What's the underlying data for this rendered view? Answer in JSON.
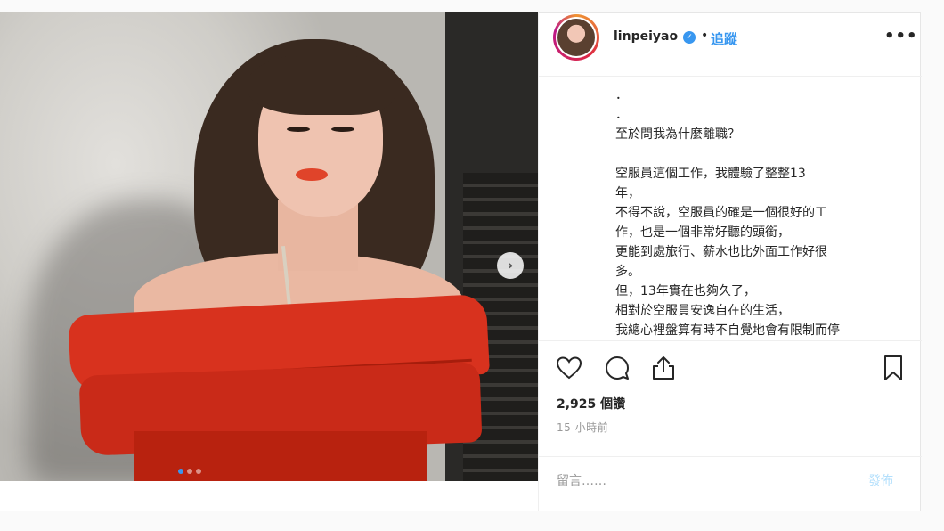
{
  "header": {
    "username": "linpeiyao",
    "separator": "•",
    "follow_label": "追蹤",
    "more_label": "•••"
  },
  "caption": {
    "lines": [
      "．",
      "．",
      "至於問我為什麼離職？",
      "",
      "空服員這個工作，我體驗了整整13",
      "年，",
      "不得不說，空服員的確是一個很好的工",
      "作，也是一個非常好聽的頭銜，",
      "更能到處旅行、薪水也比外面工作好很",
      "多。",
      "但，13年實在也夠久了，",
      "相對於空服員安逸自在的生活，",
      "我總心裡盤算有時不自覺地會有限制而停"
    ]
  },
  "media": {
    "carousel_dots": 3,
    "active_dot": 0
  },
  "actions": {
    "views": "2,925 個讚",
    "time": "15 小時前"
  },
  "comment": {
    "placeholder": "留言……",
    "post_label": "發佈"
  },
  "colors": {
    "accent": "#3897f0",
    "dress": "#d8321e"
  }
}
